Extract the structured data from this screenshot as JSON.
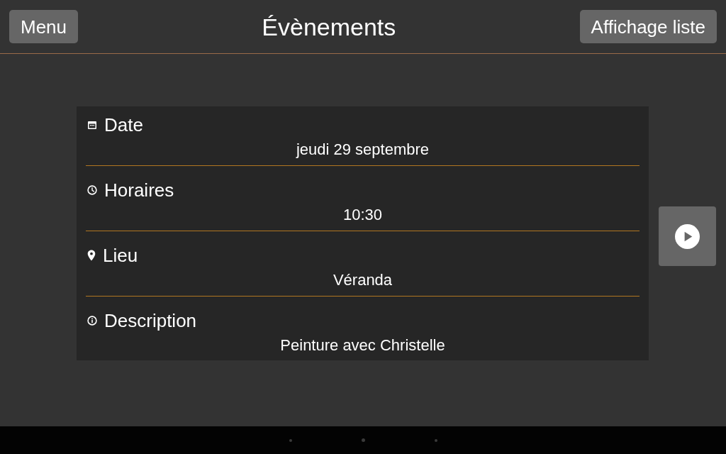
{
  "header": {
    "menu_button": "Menu",
    "title": "Évènements",
    "view_button": "Affichage liste"
  },
  "event": {
    "fields": [
      {
        "kind": "date",
        "label": "Date",
        "value": "jeudi 29 septembre"
      },
      {
        "kind": "time",
        "label": "Horaires",
        "value": "10:30"
      },
      {
        "kind": "place",
        "label": "Lieu",
        "value": "Véranda"
      },
      {
        "kind": "info",
        "label": "Description",
        "value": "Peinture avec Christelle"
      }
    ]
  }
}
